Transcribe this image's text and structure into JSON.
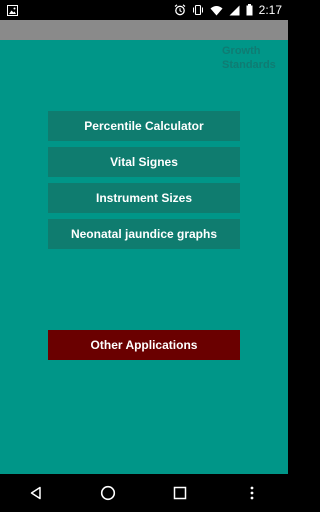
{
  "status_bar": {
    "time": "2:17",
    "icons": [
      "image-notification-icon",
      "alarm-icon",
      "vibrate-icon",
      "wifi-icon",
      "signal-icon",
      "battery-icon"
    ]
  },
  "app": {
    "corner_title_line1": "Growth",
    "corner_title_line2": "Standards"
  },
  "menu": {
    "items": [
      {
        "label": "Percentile Calculator"
      },
      {
        "label": "Vital Signes"
      },
      {
        "label": "Instrument Sizes"
      },
      {
        "label": "Neonatal jaundice graphs"
      }
    ],
    "other_apps_label": "Other Applications"
  },
  "nav_bar": {
    "icons": [
      "back-icon",
      "home-icon",
      "recents-icon",
      "more-icon"
    ]
  },
  "colors": {
    "background": "#009688",
    "button": "#0f7c6f",
    "other_button": "#6a0000",
    "app_bar": "#8a8a8a"
  }
}
